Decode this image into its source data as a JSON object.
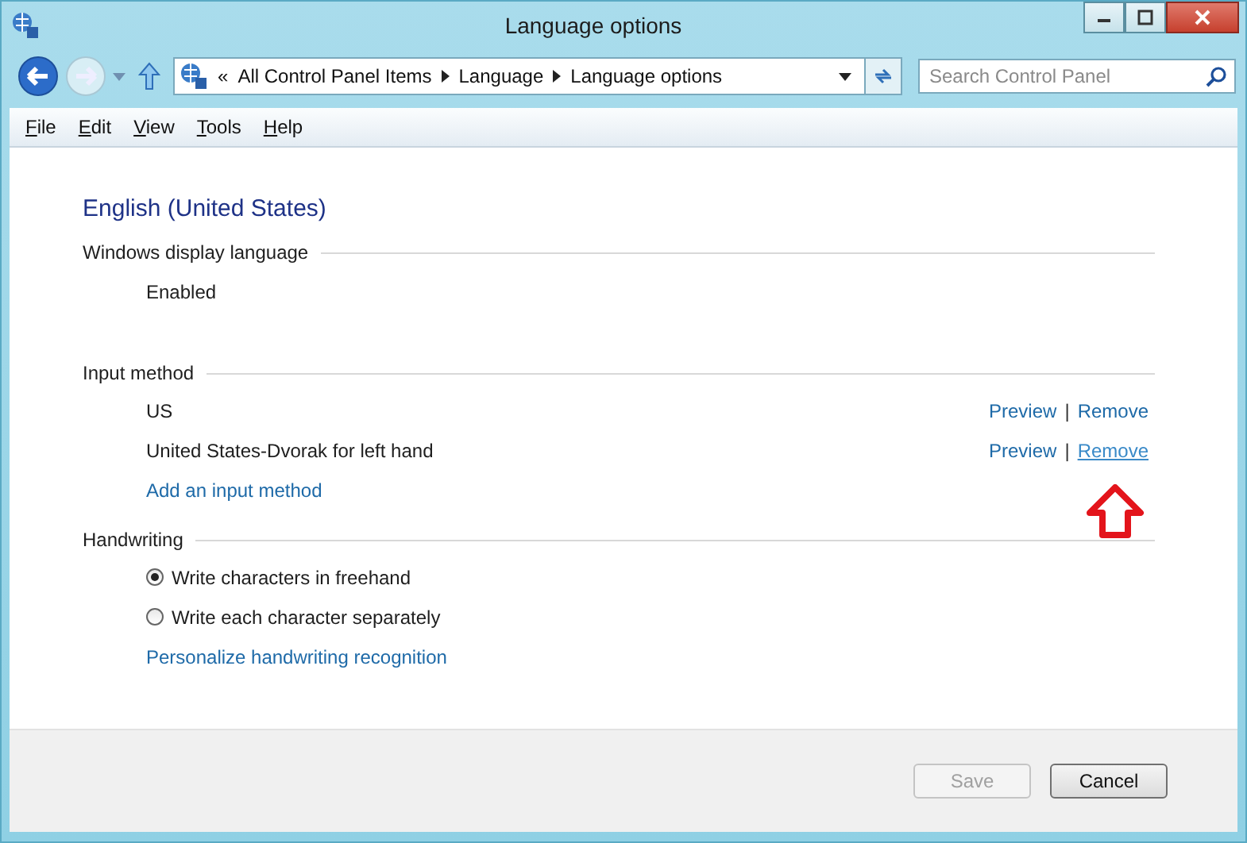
{
  "window": {
    "title": "Language options"
  },
  "address_bar": {
    "chevron": "«",
    "crumbs": [
      "All Control Panel Items",
      "Language",
      "Language options"
    ]
  },
  "search": {
    "placeholder": "Search Control Panel"
  },
  "menu": [
    "File",
    "Edit",
    "View",
    "Tools",
    "Help"
  ],
  "heading": "English (United States)",
  "sections": [
    {
      "title": "Windows display language",
      "rows": [
        {
          "kind": "text",
          "label": "Enabled"
        }
      ]
    },
    {
      "title": "Input method",
      "rows": [
        {
          "kind": "method",
          "label": "US",
          "separator": "|",
          "actions": [
            {
              "label": "Preview",
              "hovered": false
            },
            {
              "label": "Remove",
              "hovered": false
            }
          ]
        },
        {
          "kind": "method",
          "label": "United States-Dvorak for left hand",
          "separator": "|",
          "actions": [
            {
              "label": "Preview",
              "hovered": false
            },
            {
              "label": "Remove",
              "hovered": true
            }
          ]
        },
        {
          "kind": "link",
          "label": "Add an input method"
        }
      ]
    },
    {
      "title": "Handwriting",
      "rows": [
        {
          "kind": "radio",
          "label": "Write characters in freehand",
          "selected": true
        },
        {
          "kind": "radio",
          "label": "Write each character separately",
          "selected": false
        },
        {
          "kind": "link",
          "label": "Personalize handwriting recognition"
        }
      ]
    }
  ],
  "buttons": [
    {
      "label": "Save",
      "disabled": true
    },
    {
      "label": "Cancel",
      "disabled": false
    }
  ]
}
